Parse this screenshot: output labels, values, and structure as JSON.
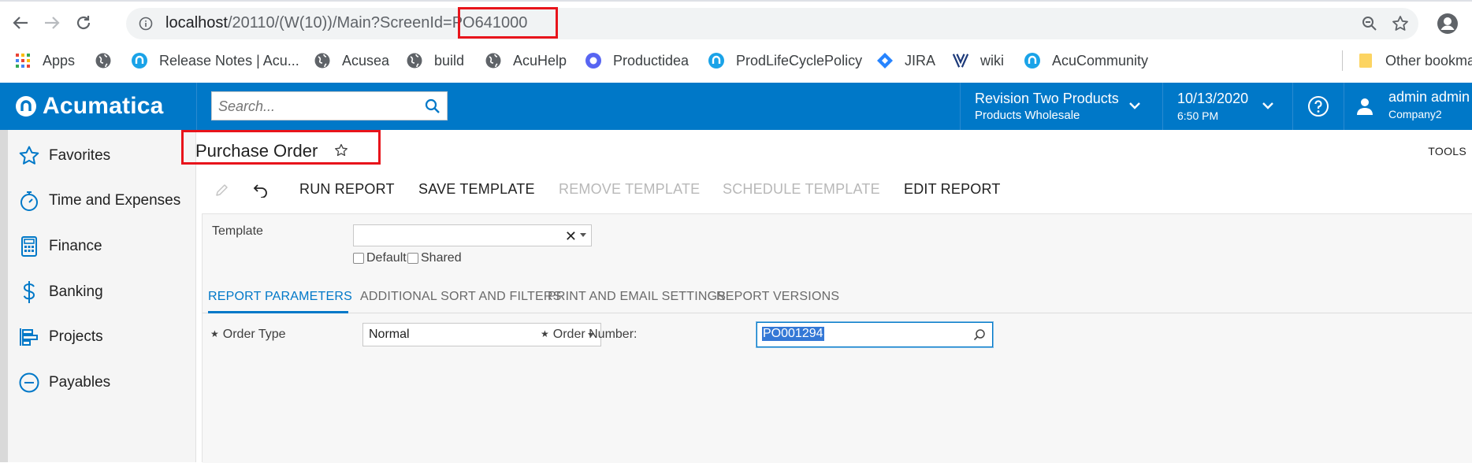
{
  "browser": {
    "url_host": "localhost",
    "url_path": "/20110/(W(10))/Main?ScreenId",
    "url_highlight": "=PO641000",
    "bookmarks": [
      "Apps",
      "Release Notes | Acu...",
      "Acusea",
      "build",
      "AcuHelp",
      "Productidea",
      "ProdLifeCyclePolicy",
      "JIRA",
      "wiki",
      "AcuCommunity"
    ],
    "other_bookmarks": "Other bookmarks"
  },
  "header": {
    "logo": "Acumatica",
    "search_placeholder": "Search...",
    "branch_line1": "Revision Two Products",
    "branch_line2": "Products Wholesale",
    "date": "10/13/2020",
    "time": "6:50 PM",
    "user_name": "admin admin",
    "user_company": "Company2"
  },
  "sidebar": {
    "items": [
      {
        "label": "Favorites",
        "icon": "star-icon"
      },
      {
        "label": "Time and Expenses",
        "icon": "stopwatch-icon"
      },
      {
        "label": "Finance",
        "icon": "calculator-icon"
      },
      {
        "label": "Banking",
        "icon": "dollar-icon"
      },
      {
        "label": "Projects",
        "icon": "projects-icon"
      },
      {
        "label": "Payables",
        "icon": "minus-circle-icon"
      }
    ]
  },
  "page": {
    "title": "Purchase Order",
    "tools": "TOOLS"
  },
  "toolbar": {
    "run_report": "RUN REPORT",
    "save_template": "SAVE TEMPLATE",
    "remove_template": "REMOVE TEMPLATE",
    "schedule_template": "SCHEDULE TEMPLATE",
    "edit_report": "EDIT REPORT"
  },
  "form": {
    "template_label": "Template",
    "template_value": "",
    "default_label": "Default",
    "shared_label": "Shared",
    "tabs": [
      "REPORT PARAMETERS",
      "ADDITIONAL SORT AND FILTERS",
      "PRINT AND EMAIL SETTINGS",
      "REPORT VERSIONS"
    ],
    "order_type_label": "Order Type",
    "order_type_value": "Normal",
    "order_number_label": "Order Number:",
    "order_number_value": "PO001294"
  },
  "colors": {
    "brand_blue": "#0078c8",
    "highlight_red": "#e8141b"
  }
}
